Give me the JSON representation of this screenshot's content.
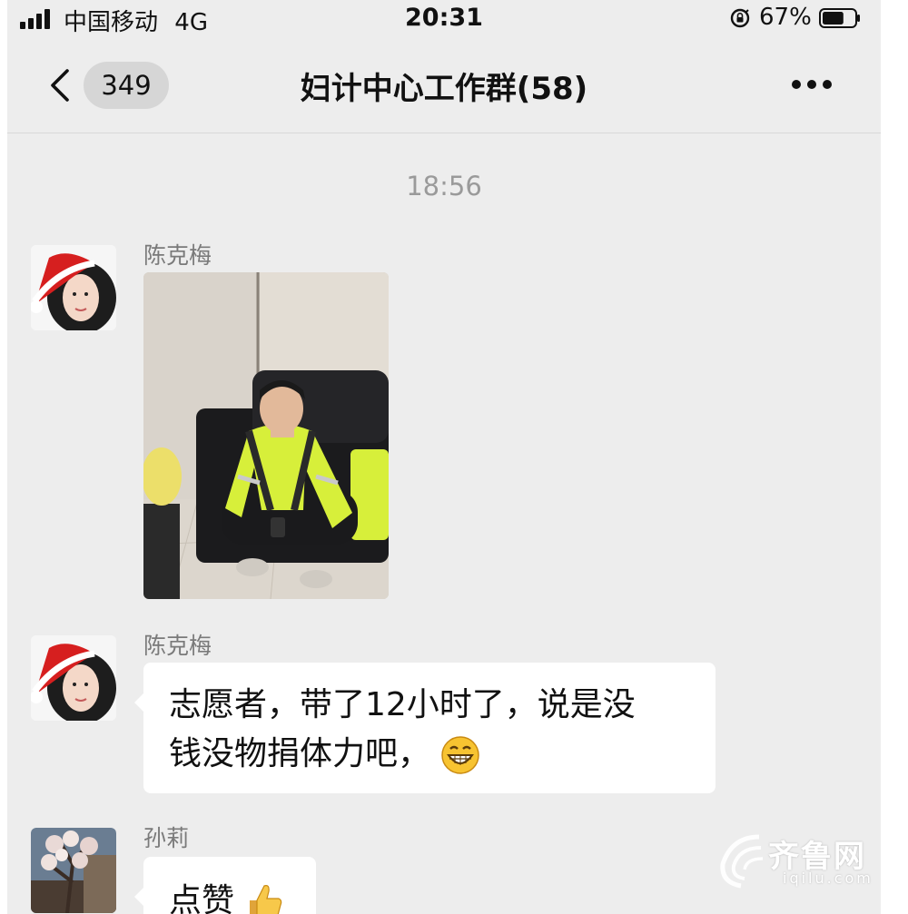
{
  "status_bar": {
    "carrier": "中国移动",
    "network": "4G",
    "time": "20:31",
    "battery": "67%",
    "battery_level": 0.67
  },
  "nav": {
    "unread_count": "349",
    "title": "妇计中心工作群(58)"
  },
  "chat": {
    "timestamp": "18:56",
    "messages": [
      {
        "sender": "陈克梅",
        "type": "image"
      },
      {
        "sender": "陈克梅",
        "type": "text",
        "line1": "志愿者，带了12小时了，说是没",
        "line2": "钱没物捐体力吧，",
        "emoji": "grinning-face-emoji"
      },
      {
        "sender": "孙莉",
        "type": "text",
        "text": "点赞",
        "emoji": "thumbs-up-emoji"
      }
    ]
  },
  "watermark": {
    "brand": "齐鲁网",
    "domain": "iqilu.com"
  },
  "colors": {
    "background": "#ededed",
    "bubble": "#ffffff",
    "hivis_yellow": "#d7ef3a",
    "meta_text": "#7a7a7a"
  }
}
